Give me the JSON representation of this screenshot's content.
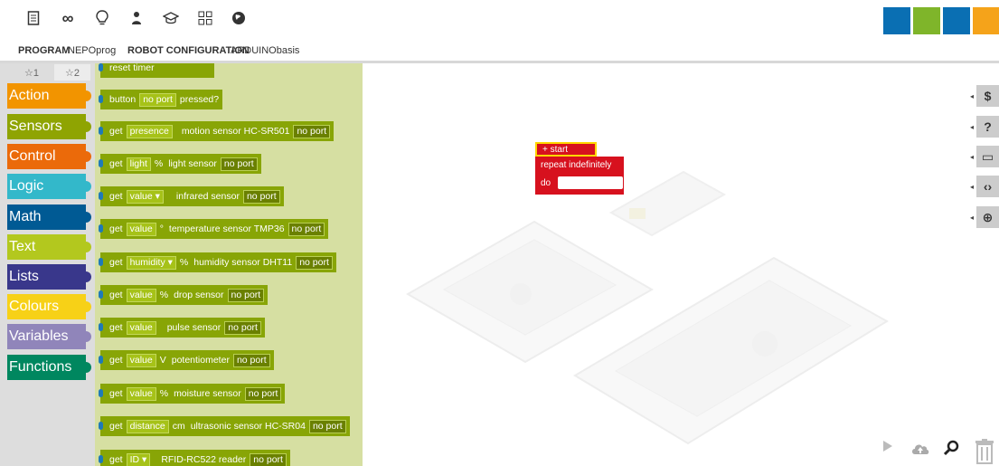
{
  "topbar": {
    "icons": [
      "document-icon",
      "infinity-icon",
      "lightbulb-icon",
      "user-icon",
      "graduation-cap-icon",
      "grid-icon",
      "globe-icon"
    ],
    "logo_colors": [
      "#0a6fb3",
      "#7fb52a",
      "#f5a31a",
      "#f9d51c"
    ]
  },
  "program_bar": {
    "program_label": "PROGRAM",
    "program_name": "NEPOprog",
    "config_label": "ROBOT CONFIGURATION",
    "config_name": "ARDUINObasis"
  },
  "category_tabs": [
    "☆1",
    "☆2"
  ],
  "categories": [
    {
      "label": "Action",
      "color": "#f29400"
    },
    {
      "label": "Sensors",
      "color": "#8fa402"
    },
    {
      "label": "Control",
      "color": "#eb6a0a"
    },
    {
      "label": "Logic",
      "color": "#33b8ca"
    },
    {
      "label": "Math",
      "color": "#005a94"
    },
    {
      "label": "Text",
      "color": "#b3c81e"
    },
    {
      "label": "Lists",
      "color": "#39378b"
    },
    {
      "label": "Colours",
      "color": "#f7d117"
    },
    {
      "label": "Variables",
      "color": "#9085ba"
    },
    {
      "label": "Functions",
      "color": "#00875f"
    }
  ],
  "blocks": {
    "partial_top": "reset  timer",
    "button": {
      "pre": "button",
      "port": "no port",
      "post": "pressed?"
    },
    "presence": {
      "get": "get",
      "field": "presence",
      "sensor": "motion sensor HC-SR501",
      "port": "no port"
    },
    "light": {
      "get": "get",
      "field": "light",
      "unit": "%",
      "sensor": "light sensor",
      "port": "no port"
    },
    "infrared": {
      "get": "get",
      "field": "value ▾",
      "sensor": "infrared sensor",
      "port": "no port"
    },
    "temperature": {
      "get": "get",
      "field": "value",
      "unit": "°",
      "sensor": "temperature sensor TMP36",
      "port": "no port"
    },
    "humidity": {
      "get": "get",
      "field": "humidity ▾",
      "unit": "%",
      "sensor": "humidity sensor DHT11",
      "port": "no port"
    },
    "drop": {
      "get": "get",
      "field": "value",
      "unit": "%",
      "sensor": "drop sensor",
      "port": "no port"
    },
    "pulse": {
      "get": "get",
      "field": "value",
      "sensor": "pulse sensor",
      "port": "no port"
    },
    "potentiometer": {
      "get": "get",
      "field": "value",
      "unit": "V",
      "sensor": "potentiometer",
      "port": "no port"
    },
    "moisture": {
      "get": "get",
      "field": "value",
      "unit": "%",
      "sensor": "moisture sensor",
      "port": "no port"
    },
    "ultrasonic": {
      "get": "get",
      "field": "distance",
      "unit": "cm",
      "sensor": "ultrasonic sensor HC-SR04",
      "port": "no port"
    },
    "rfid": {
      "get": "get",
      "field": "ID ▾",
      "sensor": "RFID-RC522 reader",
      "port": "no port"
    }
  },
  "start_block": {
    "header": "+  start",
    "repeat": "repeat indefinitely",
    "do": "do"
  },
  "right_toolbar": [
    "$",
    "?",
    "▭",
    "‹›",
    "⊕"
  ],
  "controls": [
    "play-icon",
    "cloud-upload-icon",
    "zoom-icon",
    "trash-icon"
  ]
}
